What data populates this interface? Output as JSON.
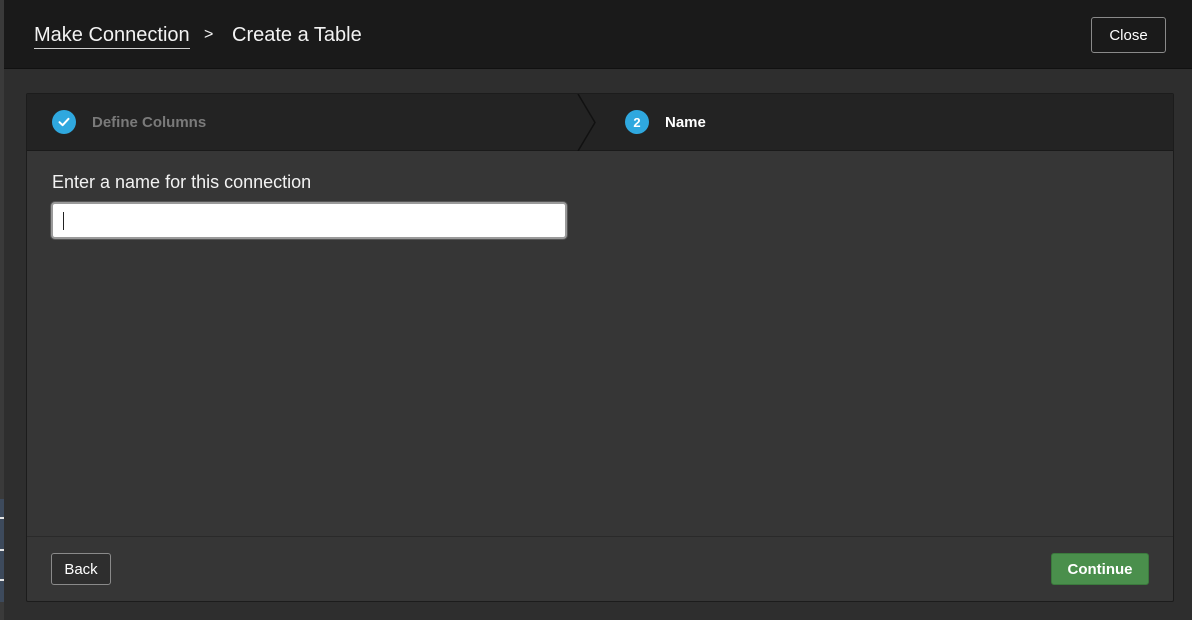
{
  "header": {
    "breadcrumb_parent": "Make Connection",
    "breadcrumb_separator": ">",
    "breadcrumb_current": "Create a Table",
    "close_label": "Close"
  },
  "steps": [
    {
      "label": "Define Columns",
      "state": "completed",
      "icon": "check-icon"
    },
    {
      "label": "Name",
      "number": "2",
      "state": "active"
    }
  ],
  "form": {
    "label": "Enter a name for this connection",
    "value": "",
    "placeholder": ""
  },
  "footer": {
    "back_label": "Back",
    "continue_label": "Continue"
  },
  "colors": {
    "accent": "#2fa8df",
    "continue": "#4a8f4c",
    "header_bg": "#1a1a1a",
    "panel_bg": "#363636"
  }
}
